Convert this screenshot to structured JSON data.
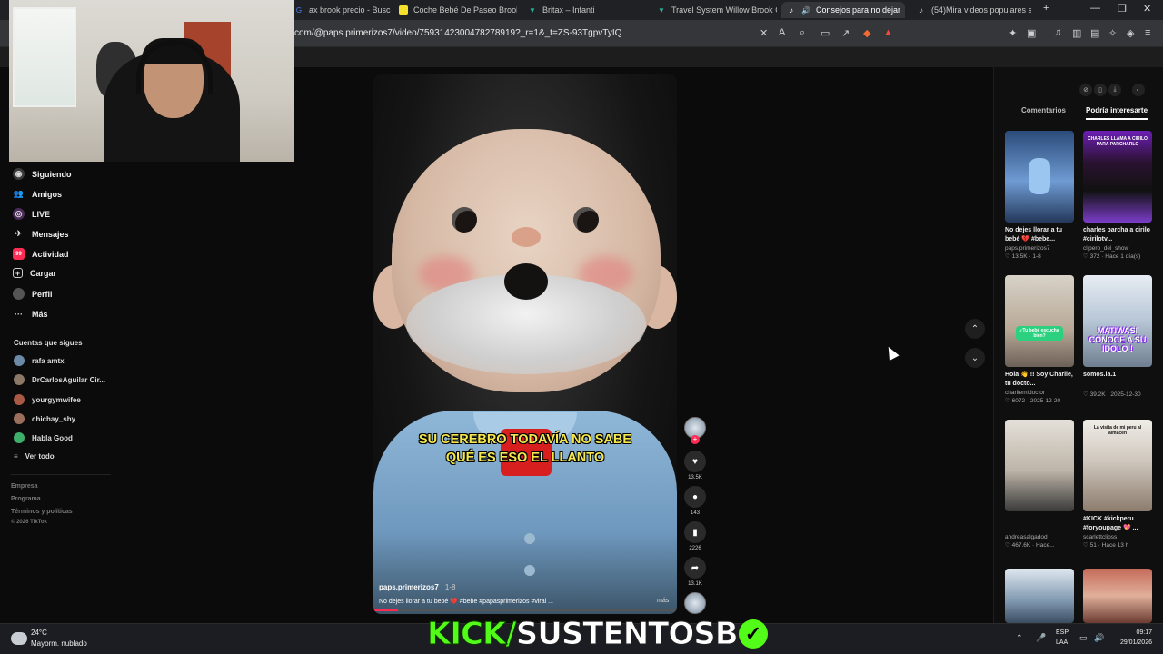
{
  "tabs": [
    {
      "label": "ax brook precio - Buscar co",
      "icon": "search-icon",
      "color": "#4285f4"
    },
    {
      "label": "Coche Bebé De Paseo Brook C",
      "icon": "mercadolibre-icon",
      "color": "#f5e12b"
    },
    {
      "label": "Britax – Infanti",
      "icon": "store-icon",
      "color": "#2bb3a0"
    },
    {
      "label": "Travel System Willow Brook Or",
      "icon": "store-icon",
      "color": "#2bb3a0"
    },
    {
      "label": "Consejos para no dejar",
      "icon": "tiktok-icon",
      "color": "#ffffff",
      "active": true
    },
    {
      "label": "(54)Mira videos populares sele",
      "icon": "tiktok-icon",
      "color": "#ffffff"
    }
  ],
  "url": "com/@paps.primerizos7/video/7593142300478278919?_r=1&_t=ZS-93TgpvTyIQ",
  "nav": [
    {
      "label": "Siguiendo",
      "icon": "following-icon"
    },
    {
      "label": "Amigos",
      "icon": "friends-icon"
    },
    {
      "label": "LIVE",
      "icon": "live-icon"
    },
    {
      "label": "Mensajes",
      "icon": "messages-icon"
    },
    {
      "label": "Actividad",
      "icon": "activity-icon",
      "badge": "99"
    },
    {
      "label": "Cargar",
      "icon": "upload-icon"
    },
    {
      "label": "Perfil",
      "icon": "profile-icon"
    },
    {
      "label": "Más",
      "icon": "more-icon"
    }
  ],
  "following_title": "Cuentas que sigues",
  "following": [
    {
      "name": "rafa amtx",
      "color": "#6c8aa8"
    },
    {
      "name": "DrCarlosAguilar Cir...",
      "color": "#8b7866"
    },
    {
      "name": "yourgymwifee",
      "color": "#a85a44"
    },
    {
      "name": "chichay_shy",
      "color": "#9b6f5b"
    },
    {
      "name": "Habla Good",
      "color": "#3fae6b"
    }
  ],
  "see_all": "Ver todo",
  "footer": [
    "Empresa",
    "Programa",
    "Términos y políticas",
    "© 2026 TikTok"
  ],
  "video": {
    "caption_line1": "SU CEREBRO TODAVÍA NO SABE",
    "caption_line2": "QUÉ ES ESO EL LLANTO",
    "author": "paps.primerizos7",
    "date": " · 1-8",
    "description": "No dejes llorar a tu bebé 💔 #bebe #papasprimerizos #viral ...",
    "more": "más",
    "progress": 0.08
  },
  "actions": {
    "likes": "13.5K",
    "comments": "143",
    "saves": "2226",
    "shares": "13.1K"
  },
  "panel": {
    "tab_comments": "Comentarios",
    "tab_suggested": "Podría interesarte"
  },
  "cards": [
    {
      "title": "No dejes llorar a tu bebé 💔 #bebe...",
      "author": "paps.primerizos7",
      "meta": "♡ 13.5K · 1-8",
      "thumb_text": ""
    },
    {
      "title": "charles parcha a cirilo #cirilotv...",
      "author": "clipero_del_show",
      "meta": "♡ 372 · Hace 1 día(s)",
      "thumb_text": "CHARLES LLAMA A CIRILO PARA PARCHARLO"
    },
    {
      "title": "Hola 👋 !! Soy Charlie, tu docto...",
      "author": "charliemidoctor",
      "meta": "♡ 6072 · 2025-12-20",
      "thumb_text": "¿Tu bebé escucha bien?"
    },
    {
      "title": "somos.la.1",
      "author": "",
      "meta": "♡ 39.2K · 2025-12-30",
      "thumb_text": "MATIWASI CONOCE A SU IDOLO !"
    },
    {
      "title": "",
      "author": "andreasalgadod",
      "meta": "♡ 467.6K · Hace...",
      "thumb_text": ""
    },
    {
      "title": "#KICK #kickperu #foryoupage 💖 ...",
      "author": "scarlettclipss",
      "meta": "♡ 51 · Hace 13 h",
      "thumb_text": "La visita de mi peru al almacen"
    },
    {
      "title": "",
      "author": "",
      "meta": "",
      "thumb_text": ""
    },
    {
      "title": "",
      "author": "",
      "meta": "",
      "thumb_text": ""
    }
  ],
  "taskbar": {
    "temp": "24°C",
    "condition": "Mayorm. nublado",
    "overlay_a": "KICK/",
    "overlay_b": "SUSTENTOSB",
    "lang_1": "ESP",
    "lang_2": "LAA",
    "time": "09:17",
    "date": "29/01/2026"
  }
}
